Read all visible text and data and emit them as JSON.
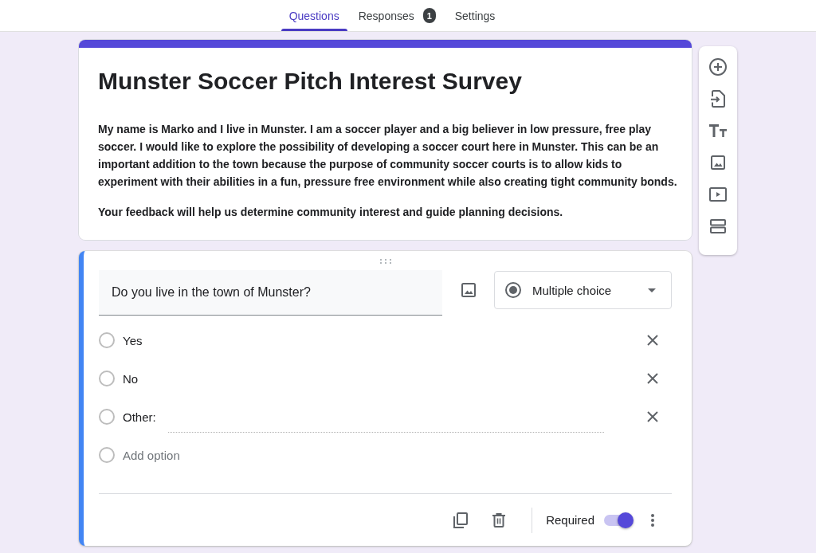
{
  "tabs": [
    {
      "label": "Questions",
      "selected": true
    },
    {
      "label": "Responses",
      "selected": false,
      "badge": "1"
    },
    {
      "label": "Settings",
      "selected": false
    }
  ],
  "form_header": {
    "title": "Munster Soccer Pitch Interest Survey",
    "description": [
      "My name is Marko and I live in Munster. I am a soccer player and a big believer in low pressure, free play soccer. I would like to explore the possibility of developing a soccer court here in Munster. This can be an important addition to the town because the purpose of community soccer courts is to allow kids to experiment with their abilities in a fun, pressure free environment while also creating tight community bonds.",
      "Your feedback will help us determine community interest and guide planning decisions."
    ]
  },
  "question": {
    "title": "Do you live in the town of Munster?",
    "type": "Multiple choice",
    "options": [
      {
        "kind": "choice",
        "label": "Yes"
      },
      {
        "kind": "choice",
        "label": "No"
      },
      {
        "kind": "other",
        "label": "Other:"
      },
      {
        "kind": "add",
        "label": "Add option"
      }
    ],
    "required_label": "Required",
    "required": true
  }
}
